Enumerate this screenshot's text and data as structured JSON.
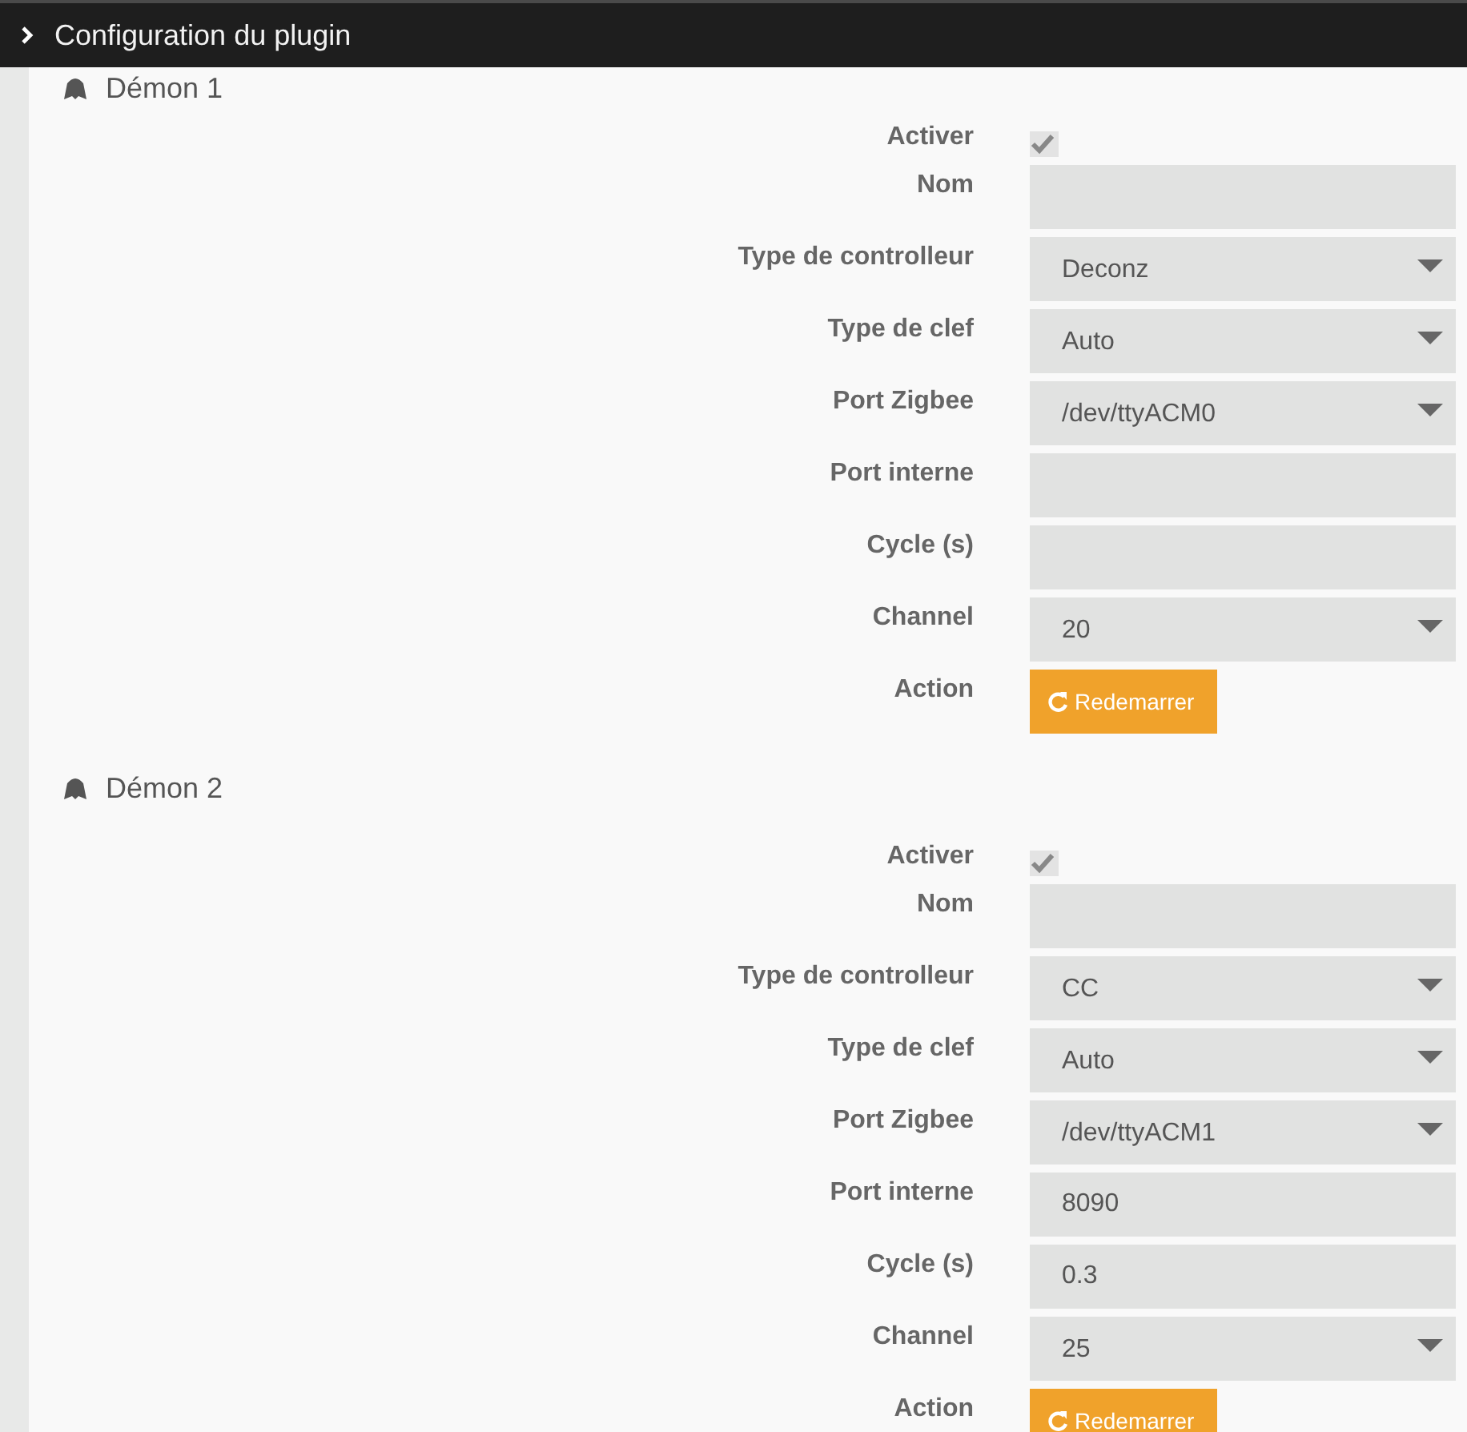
{
  "header": {
    "title": "Configuration du plugin"
  },
  "daemons": [
    {
      "title": "Démon 1",
      "fields": [
        {
          "kind": "checkbox",
          "label": "Activer",
          "checked": true
        },
        {
          "kind": "input",
          "label": "Nom"
        },
        {
          "kind": "select",
          "label": "Type de controlleur",
          "value": "Deconz"
        },
        {
          "kind": "select",
          "label": "Type de clef",
          "value": "Auto"
        },
        {
          "kind": "select",
          "label": "Port Zigbee",
          "value": "/dev/ttyACM0"
        },
        {
          "kind": "input",
          "label": "Port interne"
        },
        {
          "kind": "input",
          "label": "Cycle (s)"
        },
        {
          "kind": "select",
          "label": "Channel",
          "value": "20"
        },
        {
          "kind": "button",
          "label": "Action",
          "button": "Redemarrer"
        }
      ]
    },
    {
      "title": "Démon 2",
      "fields": [
        {
          "kind": "checkbox",
          "label": "Activer",
          "checked": true
        },
        {
          "kind": "input",
          "label": "Nom"
        },
        {
          "kind": "select",
          "label": "Type de controlleur",
          "value": "CC"
        },
        {
          "kind": "select",
          "label": "Type de clef",
          "value": "Auto"
        },
        {
          "kind": "select",
          "label": "Port Zigbee",
          "value": "/dev/ttyACM1"
        },
        {
          "kind": "input",
          "label": "Port interne",
          "value": "8090"
        },
        {
          "kind": "input",
          "label": "Cycle (s)",
          "value": "0.3"
        },
        {
          "kind": "select",
          "label": "Channel",
          "value": "25"
        },
        {
          "kind": "button",
          "label": "Action",
          "button": "Redemarrer"
        }
      ]
    }
  ]
}
